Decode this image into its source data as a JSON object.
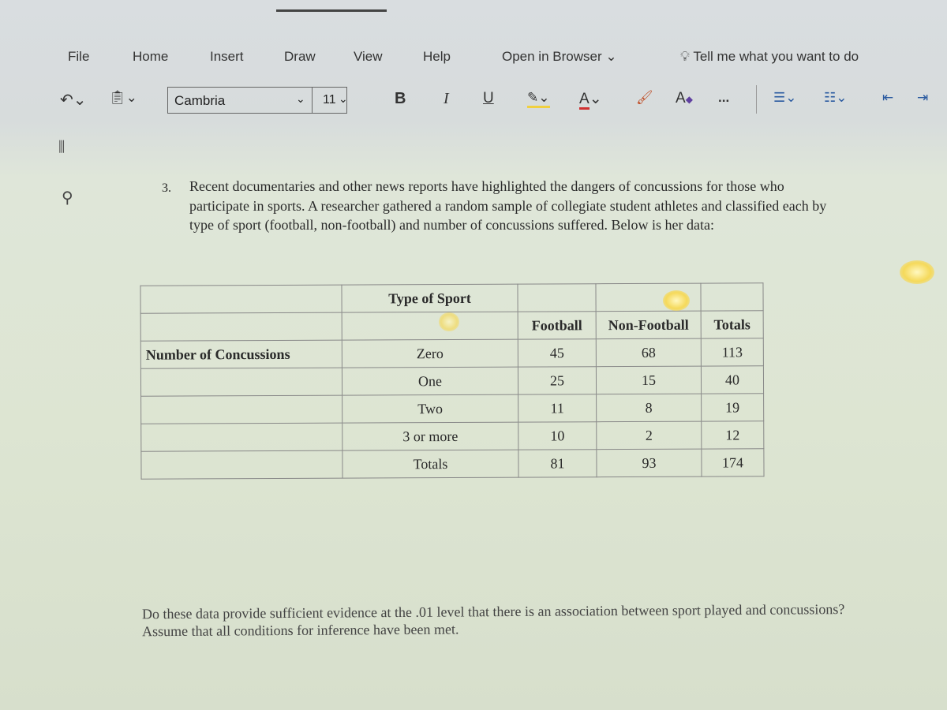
{
  "menu": {
    "items": [
      "File",
      "Home",
      "Insert",
      "Draw",
      "View",
      "Help"
    ],
    "open_in_browser": "Open in Browser",
    "tell_me": "Tell me what you want to do"
  },
  "toolbar": {
    "font_name": "Cambria",
    "font_size": "11",
    "bold": "B",
    "italic": "I",
    "underline": "U",
    "font_color": "A",
    "more": "...",
    "highlight_color": "#f0d040",
    "font_color_bar": "#d03030"
  },
  "document": {
    "question_number": "3.",
    "question_text": "Recent documentaries and other news reports have highlighted the dangers of concussions for those who participate in sports. A researcher gathered a random sample of collegiate student athletes and classified each by type of sport (football, non-football) and number of concussions suffered. Below is her data:",
    "table": {
      "group_header": "Type of Sport",
      "row_group_label": "Number of Concussions",
      "columns": [
        "Football",
        "Non-Football",
        "Totals"
      ],
      "rows": [
        {
          "label": "Zero",
          "values": [
            "45",
            "68",
            "113"
          ]
        },
        {
          "label": "One",
          "values": [
            "25",
            "15",
            "40"
          ]
        },
        {
          "label": "Two",
          "values": [
            "11",
            "8",
            "19"
          ]
        },
        {
          "label": "3 or more",
          "values": [
            "10",
            "2",
            "12"
          ]
        },
        {
          "label": "Totals",
          "values": [
            "81",
            "93",
            "174"
          ]
        }
      ]
    },
    "followup": "Do these data provide sufficient evidence at the .01 level that there is an association between sport played and concussions? Assume that all conditions for inference have been met."
  }
}
